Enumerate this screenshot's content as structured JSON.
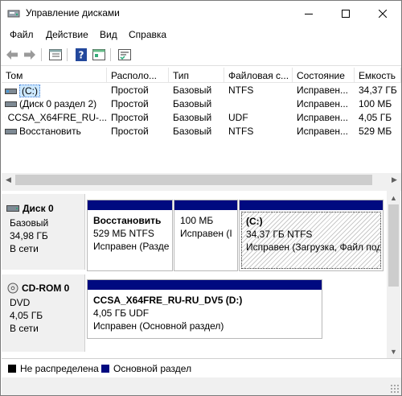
{
  "window": {
    "title": "Управление дисками",
    "controls": {
      "minimize": "—",
      "maximize": "☐",
      "close": "✕"
    }
  },
  "menu": [
    "Файл",
    "Действие",
    "Вид",
    "Справка"
  ],
  "toolbar": {
    "icons": [
      "back-arrow-icon",
      "forward-arrow-icon",
      "properties-icon",
      "help-icon",
      "console-icon",
      "settings-icon"
    ]
  },
  "volume_table": {
    "columns": [
      "Том",
      "Располо...",
      "Тип",
      "Файловая с...",
      "Состояние",
      "Емкость"
    ],
    "rows": [
      {
        "name": "(C:)",
        "icon": "drive-icon",
        "layout": "Простой",
        "type": "Базовый",
        "fs": "NTFS",
        "status": "Исправен...",
        "capacity": "34,37 ГБ",
        "selected": true
      },
      {
        "name": "(Диск 0 раздел 2)",
        "icon": "drive-icon",
        "layout": "Простой",
        "type": "Базовый",
        "fs": "",
        "status": "Исправен...",
        "capacity": "100 МБ"
      },
      {
        "name": "CCSA_X64FRE_RU-...",
        "icon": "optical-disc-icon",
        "layout": "Простой",
        "type": "Базовый",
        "fs": "UDF",
        "status": "Исправен...",
        "capacity": "4,05 ГБ"
      },
      {
        "name": "Восстановить",
        "icon": "drive-icon",
        "layout": "Простой",
        "type": "Базовый",
        "fs": "NTFS",
        "status": "Исправен...",
        "capacity": "529 МБ"
      }
    ]
  },
  "disks": [
    {
      "title": "Диск 0",
      "icon": "disk-icon",
      "lines": [
        "Базовый",
        "34,98 ГБ",
        "В сети"
      ],
      "partitions": [
        {
          "lines": [
            "Восстановить",
            "529 МБ NTFS",
            "Исправен (Разде"
          ],
          "bold_first": true,
          "hatched": false
        },
        {
          "lines": [
            "",
            "100 МБ",
            "Исправен (I"
          ],
          "bold_first": false,
          "hatched": false
        },
        {
          "lines": [
            "(C:)",
            "34,37 ГБ NTFS",
            "Исправен (Загрузка, Файл под"
          ],
          "bold_first": true,
          "hatched": true
        }
      ]
    },
    {
      "title": "CD-ROM 0",
      "icon": "cdrom-icon",
      "lines": [
        "DVD",
        "4,05 ГБ",
        "В сети"
      ],
      "partitions": [
        {
          "lines": [
            "CCSA_X64FRE_RU-RU_DV5  (D:)",
            "4,05 ГБ UDF",
            "Исправен (Основной раздел)"
          ],
          "bold_first": true,
          "hatched": false
        }
      ]
    }
  ],
  "legend": [
    {
      "label": "Не распределена",
      "color": "#000000"
    },
    {
      "label": "Основной раздел",
      "color": "#000a80"
    }
  ],
  "colors": {
    "partition_bar": "#000a80",
    "selection": "#cce8ff"
  }
}
